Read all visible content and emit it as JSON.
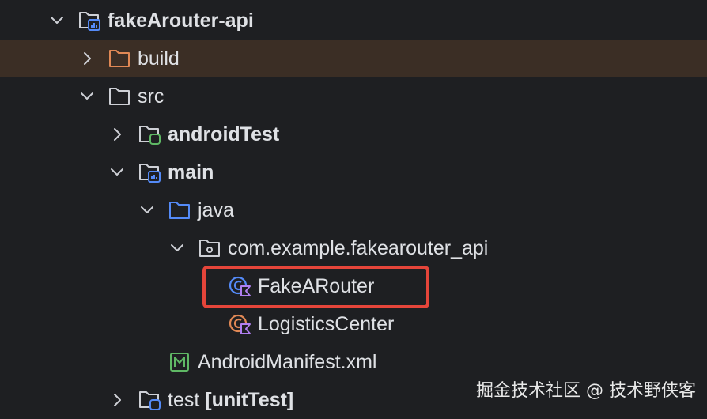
{
  "tree": [
    {
      "label": "fakeArouter-api",
      "bold": true,
      "expanded": true,
      "icon": "module-folder-icon"
    },
    {
      "label": "build",
      "bold": false,
      "expanded": false,
      "icon": "excluded-folder-icon",
      "highlighted": true
    },
    {
      "label": "src",
      "bold": false,
      "expanded": true,
      "icon": "folder-icon"
    },
    {
      "label": "androidTest",
      "bold": true,
      "expanded": false,
      "icon": "test-source-folder-icon"
    },
    {
      "label": "main",
      "bold": true,
      "expanded": true,
      "icon": "module-folder-icon"
    },
    {
      "label": "java",
      "bold": false,
      "expanded": true,
      "icon": "source-root-folder-icon"
    },
    {
      "label": "com.example.fakearouter_api",
      "bold": false,
      "expanded": true,
      "icon": "package-icon"
    },
    {
      "label": "FakeARouter",
      "bold": false,
      "icon": "kotlin-class-icon",
      "selected": true
    },
    {
      "label": "LogisticsCenter",
      "bold": false,
      "icon": "kotlin-object-icon"
    },
    {
      "label": "AndroidManifest.xml",
      "bold": false,
      "icon": "manifest-icon"
    },
    {
      "label": "test",
      "suffix": "[unitTest]",
      "bold": true,
      "expanded": false,
      "icon": "test-folder-icon"
    }
  ],
  "watermark": "掘金技术社区 @ 技术野侠客",
  "colors": {
    "background": "#1e1f22",
    "highlight_row": "#3b2e25",
    "selection_outline": "#e5453a",
    "folder_stroke": "#ced0d6",
    "excluded_folder": "#e08855",
    "source_folder": "#548af7",
    "test_badge": "#5fb865",
    "kotlin_accent": "#b07ff0"
  }
}
